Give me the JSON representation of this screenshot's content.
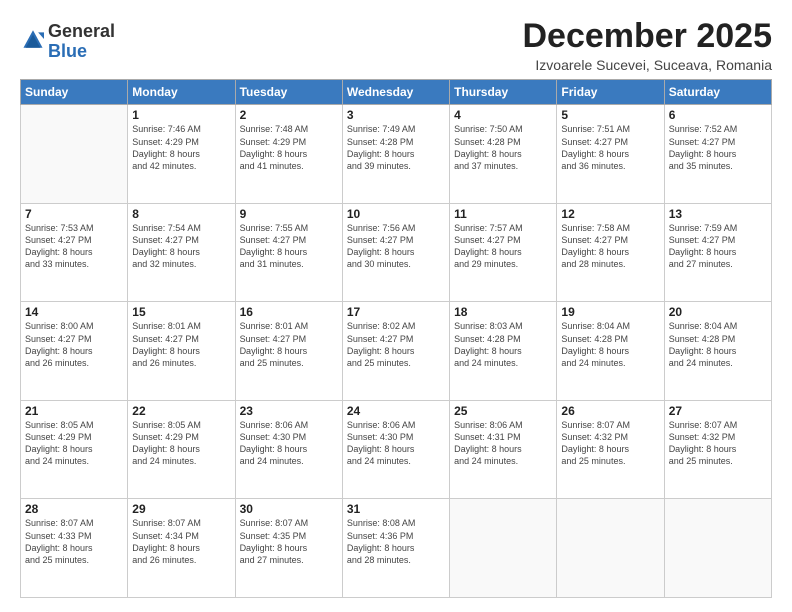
{
  "header": {
    "logo_general": "General",
    "logo_blue": "Blue",
    "month_title": "December 2025",
    "subtitle": "Izvoarele Sucevei, Suceava, Romania"
  },
  "weekdays": [
    "Sunday",
    "Monday",
    "Tuesday",
    "Wednesday",
    "Thursday",
    "Friday",
    "Saturday"
  ],
  "weeks": [
    [
      {
        "num": "",
        "info": ""
      },
      {
        "num": "1",
        "info": "Sunrise: 7:46 AM\nSunset: 4:29 PM\nDaylight: 8 hours\nand 42 minutes."
      },
      {
        "num": "2",
        "info": "Sunrise: 7:48 AM\nSunset: 4:29 PM\nDaylight: 8 hours\nand 41 minutes."
      },
      {
        "num": "3",
        "info": "Sunrise: 7:49 AM\nSunset: 4:28 PM\nDaylight: 8 hours\nand 39 minutes."
      },
      {
        "num": "4",
        "info": "Sunrise: 7:50 AM\nSunset: 4:28 PM\nDaylight: 8 hours\nand 37 minutes."
      },
      {
        "num": "5",
        "info": "Sunrise: 7:51 AM\nSunset: 4:27 PM\nDaylight: 8 hours\nand 36 minutes."
      },
      {
        "num": "6",
        "info": "Sunrise: 7:52 AM\nSunset: 4:27 PM\nDaylight: 8 hours\nand 35 minutes."
      }
    ],
    [
      {
        "num": "7",
        "info": "Sunrise: 7:53 AM\nSunset: 4:27 PM\nDaylight: 8 hours\nand 33 minutes."
      },
      {
        "num": "8",
        "info": "Sunrise: 7:54 AM\nSunset: 4:27 PM\nDaylight: 8 hours\nand 32 minutes."
      },
      {
        "num": "9",
        "info": "Sunrise: 7:55 AM\nSunset: 4:27 PM\nDaylight: 8 hours\nand 31 minutes."
      },
      {
        "num": "10",
        "info": "Sunrise: 7:56 AM\nSunset: 4:27 PM\nDaylight: 8 hours\nand 30 minutes."
      },
      {
        "num": "11",
        "info": "Sunrise: 7:57 AM\nSunset: 4:27 PM\nDaylight: 8 hours\nand 29 minutes."
      },
      {
        "num": "12",
        "info": "Sunrise: 7:58 AM\nSunset: 4:27 PM\nDaylight: 8 hours\nand 28 minutes."
      },
      {
        "num": "13",
        "info": "Sunrise: 7:59 AM\nSunset: 4:27 PM\nDaylight: 8 hours\nand 27 minutes."
      }
    ],
    [
      {
        "num": "14",
        "info": "Sunrise: 8:00 AM\nSunset: 4:27 PM\nDaylight: 8 hours\nand 26 minutes."
      },
      {
        "num": "15",
        "info": "Sunrise: 8:01 AM\nSunset: 4:27 PM\nDaylight: 8 hours\nand 26 minutes."
      },
      {
        "num": "16",
        "info": "Sunrise: 8:01 AM\nSunset: 4:27 PM\nDaylight: 8 hours\nand 25 minutes."
      },
      {
        "num": "17",
        "info": "Sunrise: 8:02 AM\nSunset: 4:27 PM\nDaylight: 8 hours\nand 25 minutes."
      },
      {
        "num": "18",
        "info": "Sunrise: 8:03 AM\nSunset: 4:28 PM\nDaylight: 8 hours\nand 24 minutes."
      },
      {
        "num": "19",
        "info": "Sunrise: 8:04 AM\nSunset: 4:28 PM\nDaylight: 8 hours\nand 24 minutes."
      },
      {
        "num": "20",
        "info": "Sunrise: 8:04 AM\nSunset: 4:28 PM\nDaylight: 8 hours\nand 24 minutes."
      }
    ],
    [
      {
        "num": "21",
        "info": "Sunrise: 8:05 AM\nSunset: 4:29 PM\nDaylight: 8 hours\nand 24 minutes."
      },
      {
        "num": "22",
        "info": "Sunrise: 8:05 AM\nSunset: 4:29 PM\nDaylight: 8 hours\nand 24 minutes."
      },
      {
        "num": "23",
        "info": "Sunrise: 8:06 AM\nSunset: 4:30 PM\nDaylight: 8 hours\nand 24 minutes."
      },
      {
        "num": "24",
        "info": "Sunrise: 8:06 AM\nSunset: 4:30 PM\nDaylight: 8 hours\nand 24 minutes."
      },
      {
        "num": "25",
        "info": "Sunrise: 8:06 AM\nSunset: 4:31 PM\nDaylight: 8 hours\nand 24 minutes."
      },
      {
        "num": "26",
        "info": "Sunrise: 8:07 AM\nSunset: 4:32 PM\nDaylight: 8 hours\nand 25 minutes."
      },
      {
        "num": "27",
        "info": "Sunrise: 8:07 AM\nSunset: 4:32 PM\nDaylight: 8 hours\nand 25 minutes."
      }
    ],
    [
      {
        "num": "28",
        "info": "Sunrise: 8:07 AM\nSunset: 4:33 PM\nDaylight: 8 hours\nand 25 minutes."
      },
      {
        "num": "29",
        "info": "Sunrise: 8:07 AM\nSunset: 4:34 PM\nDaylight: 8 hours\nand 26 minutes."
      },
      {
        "num": "30",
        "info": "Sunrise: 8:07 AM\nSunset: 4:35 PM\nDaylight: 8 hours\nand 27 minutes."
      },
      {
        "num": "31",
        "info": "Sunrise: 8:08 AM\nSunset: 4:36 PM\nDaylight: 8 hours\nand 28 minutes."
      },
      {
        "num": "",
        "info": ""
      },
      {
        "num": "",
        "info": ""
      },
      {
        "num": "",
        "info": ""
      }
    ]
  ]
}
